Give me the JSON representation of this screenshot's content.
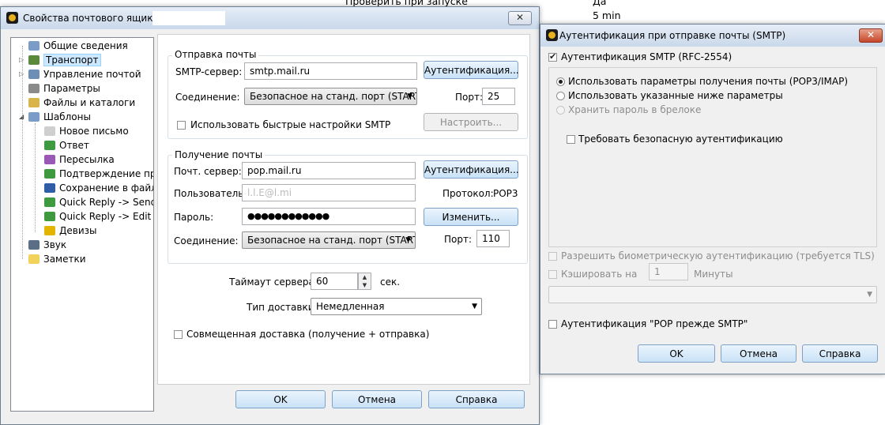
{
  "background": {
    "line1": "Проверить при запуске",
    "line1_val": "Да",
    "line2_val": "5 min"
  },
  "main": {
    "title": "Свойства почтового ящика -",
    "close": "✕",
    "tree": [
      {
        "label": "Общие сведения",
        "icon": "info-icon",
        "color": "#7a9cc6"
      },
      {
        "label": "Транспорт",
        "icon": "transport-icon",
        "color": "#5b8a3c"
      },
      {
        "label": "Управление почтой",
        "icon": "mail-management-icon",
        "color": "#6e8fb5"
      },
      {
        "label": "Параметры",
        "icon": "parameters-icon",
        "color": "#8a8a8a"
      },
      {
        "label": "Файлы и каталоги",
        "icon": "folders-icon",
        "color": "#d9b44a"
      },
      {
        "label": "Шаблоны",
        "icon": "templates-icon",
        "color": "#7a9cc6"
      },
      {
        "label": "Новое письмо",
        "icon": "new-letter-icon",
        "color": "#cfcfcf"
      },
      {
        "label": "Ответ",
        "icon": "reply-icon",
        "color": "#3f9a3f"
      },
      {
        "label": "Пересылка",
        "icon": "forward-icon",
        "color": "#9b59b6"
      },
      {
        "label": "Подтверждение проч",
        "icon": "receipt-icon",
        "color": "#3f9a3f"
      },
      {
        "label": "Сохранение в файл",
        "icon": "save-icon",
        "color": "#2f5da8"
      },
      {
        "label": "Quick Reply -> Send",
        "icon": "quick-reply-send-icon",
        "color": "#3f9a3f"
      },
      {
        "label": "Quick Reply -> Edit",
        "icon": "quick-reply-edit-icon",
        "color": "#3f9a3f"
      },
      {
        "label": "Девизы",
        "icon": "mottos-icon",
        "color": "#e2b600"
      },
      {
        "label": "Звук",
        "icon": "sound-icon",
        "color": "#5a6f85"
      },
      {
        "label": "Заметки",
        "icon": "notes-icon",
        "color": "#f3d25b"
      }
    ],
    "send": {
      "group": "Отправка почты",
      "smtp_label": "SMTP-сервер:",
      "smtp_value": "smtp.mail.ru",
      "auth_button": "Аутентификация...",
      "conn_label": "Соединение:",
      "conn_value": "Безопасное на станд. порт (STARTT",
      "port_label": "Порт:",
      "port_value": "25",
      "quick_label": "Использовать быстрые настройки SMTP",
      "configure_button": "Настроить..."
    },
    "receive": {
      "group": "Получение почты",
      "server_label": "Почт. сервер:",
      "server_value": "pop.mail.ru",
      "auth_button": "Аутентификация...",
      "user_label": "Пользователь:",
      "user_value": "l.l.E@l.mi",
      "protocol_label": "Протокол:",
      "protocol_value": "POP3",
      "password_label": "Пароль:",
      "password_value": "●●●●●●●●●●●●",
      "change_button": "Изменить...",
      "conn_label": "Соединение:",
      "conn_value": "Безопасное на станд. порт (STARTT",
      "port_label": "Порт:",
      "port_value": "110"
    },
    "timeout_label": "Таймаут сервера:",
    "timeout_value": "60",
    "timeout_unit": "сек.",
    "delivery_label": "Тип доставки:",
    "delivery_value": "Немедленная",
    "combined_label": "Совмещенная доставка (получение + отправка)",
    "ok": "OK",
    "cancel": "Отмена",
    "help": "Справка"
  },
  "auth": {
    "title": "Аутентификация при отправке почты (SMTP)",
    "close": "✕",
    "smtp_auth_label": "Аутентификация SMTP (RFC-2554)",
    "opt1": "Использовать параметры получения почты (POP3/IMAP)",
    "opt2": "Использовать указанные ниже параметры",
    "opt3": "Хранить пароль в брелоке",
    "secure_label": "Требовать безопасную аутентификацию",
    "biometric_label": "Разрешить биометрическую аутентификацию (требуется TLS)",
    "cache_label": "Кэшировать на",
    "cache_value": "1",
    "cache_unit": "Минуты",
    "pop_before_label": "Аутентификация \"POP прежде SMTP\"",
    "ok": "OK",
    "cancel": "Отмена",
    "help": "Справка"
  }
}
